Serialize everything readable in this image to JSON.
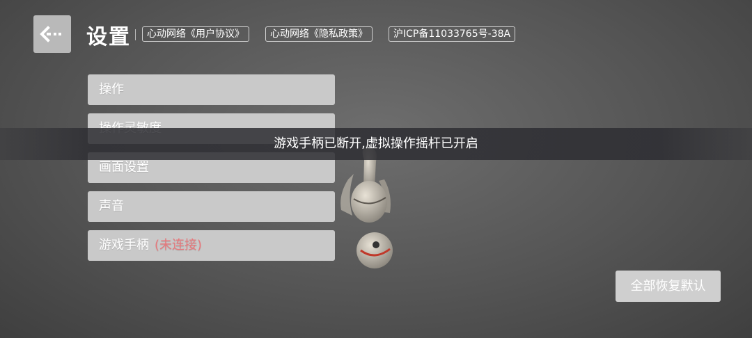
{
  "header": {
    "back_icon": "back-arrow-icon",
    "title": "设置",
    "links": [
      {
        "label": "心动网络《用户协议》"
      },
      {
        "label": "心动网络《隐私政策》"
      },
      {
        "label": "沪ICP备11033765号-38A"
      }
    ]
  },
  "menu": {
    "items": [
      {
        "label": "操作"
      },
      {
        "label": "操作灵敏度"
      },
      {
        "label": "画面设置"
      },
      {
        "label": "声音"
      },
      {
        "label": "游戏手柄",
        "status": "(未连接)"
      }
    ]
  },
  "toast": {
    "message": "游戏手柄已断开,虚拟操作摇杆已开启"
  },
  "reset_button": {
    "label": "全部恢复默认"
  },
  "colors": {
    "background": "#5a5a5a",
    "menu_item": "#c9c9c9",
    "status_red": "#e8777b",
    "toast_bg": "#2d2d32"
  }
}
